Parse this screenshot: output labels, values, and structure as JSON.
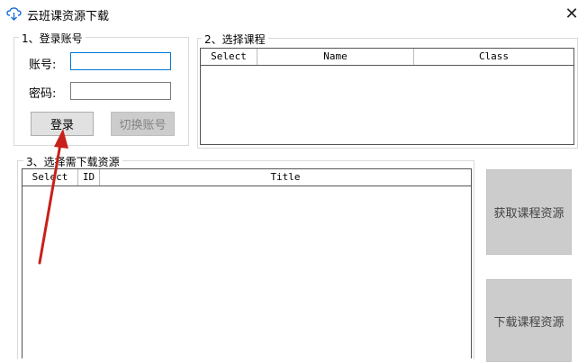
{
  "window": {
    "title": "云班课资源下载",
    "close_glyph": "✕",
    "app_icon": "cloud-download-icon"
  },
  "login": {
    "legend": "1、登录账号",
    "account_label": "账号:",
    "account_value": "",
    "password_label": "密码:",
    "password_value": "",
    "login_button": "登录",
    "switch_button": "切换账号"
  },
  "courses": {
    "legend": "2、选择课程",
    "columns": [
      "Select",
      "Name",
      "Class"
    ]
  },
  "resources": {
    "legend": "3、选择需下载资源",
    "columns": [
      "Select",
      "ID",
      "Title"
    ]
  },
  "actions": {
    "fetch_button": "获取课程资源",
    "download_button": "下载课程资源"
  },
  "annotation": {
    "color": "#c8201a"
  }
}
